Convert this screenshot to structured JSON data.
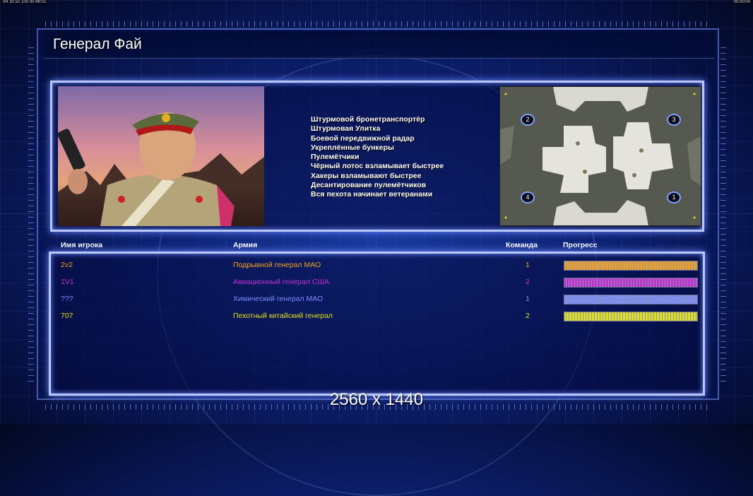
{
  "top_bar": {
    "left_text": "0R 30 50 100 00:49:02",
    "right_text": "00:00:00"
  },
  "title": "Генерал Фай",
  "features": [
    "Штурмовой бронетранспортёр",
    "Штурмовая Улитка",
    "Боевой передвижной радар",
    "Укреплённые бункеры",
    "Пулемётчики",
    "Чёрный лотос взламывает быстрее",
    "Хакеры взламывают быстрее",
    "Десантирование пулемётчиков",
    "Вся пехота начинает ветеранами"
  ],
  "map_markers": [
    "2",
    "3",
    "4",
    "1"
  ],
  "table": {
    "headers": {
      "player": "Имя игрока",
      "army": "Армия",
      "team": "Команда",
      "progress": "Прогресс"
    },
    "rows": [
      {
        "name": "2v2",
        "army": "Подрывной генерал МАО",
        "team": "1",
        "progress": 1.0,
        "color": "#f0a020"
      },
      {
        "name": "1V1",
        "army": "Авиационный генерал США",
        "team": "2",
        "progress": 1.0,
        "color": "#c030d0"
      },
      {
        "name": "???",
        "army": "Химический генерал МАО",
        "team": "1",
        "progress": 1.0,
        "color": "#7b8cff"
      },
      {
        "name": "707",
        "army": "Пехотный китайский генерал",
        "team": "2",
        "progress": 1.0,
        "color": "#e0e020"
      }
    ]
  },
  "resolution": "2560 x 1440"
}
